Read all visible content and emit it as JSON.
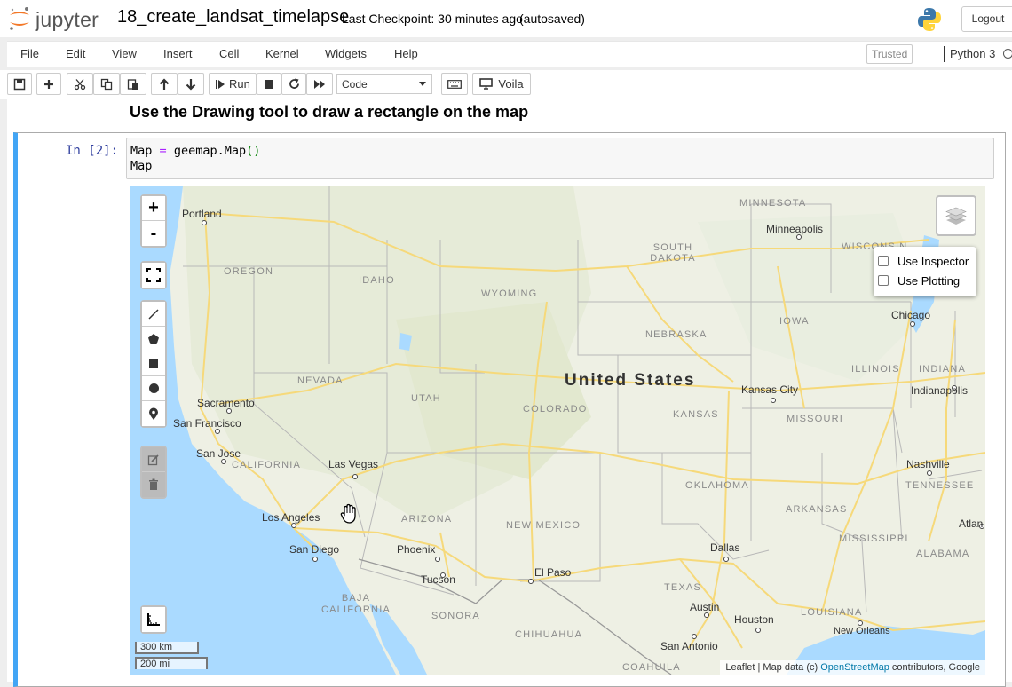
{
  "header": {
    "logo_text": "jupyter",
    "notebook_name": "18_create_landsat_timelapse",
    "checkpoint": "Last Checkpoint: 30 minutes ago",
    "autosave_status": "(autosaved)",
    "logout_label": "Logout"
  },
  "menubar": {
    "items": [
      "File",
      "Edit",
      "View",
      "Insert",
      "Cell",
      "Kernel",
      "Widgets",
      "Help"
    ],
    "trusted_label": "Trusted",
    "kernel_name": "Python 3"
  },
  "toolbar": {
    "run_label": "Run",
    "cell_type": "Code",
    "voila_label": "Voila",
    "icons": [
      "save-icon",
      "plus-icon",
      "cut-icon",
      "copy-icon",
      "paste-icon",
      "arrow-up-icon",
      "arrow-down-icon",
      "step-forward-icon",
      "stop-icon",
      "restart-icon",
      "fast-forward-icon",
      "keyboard-icon",
      "monitor-icon"
    ]
  },
  "notebook": {
    "markdown_heading": "Use the Drawing tool to draw a rectangle on the map",
    "cell": {
      "prompt": "In [2]:",
      "code_line1": {
        "var": "Map",
        "op": "=",
        "call": "geemap.Map",
        "parens": "()"
      },
      "code_line2": "Map"
    }
  },
  "map": {
    "zoom_in": "+",
    "zoom_out": "-",
    "country_label": "United States",
    "states": [
      "OREGON",
      "IDAHO",
      "WYOMING",
      "SOUTH DAKOTA",
      "MINNESOTA",
      "WISCONSIN",
      "IOWA",
      "NEBRASKA",
      "NEVADA",
      "UTAH",
      "COLORADO",
      "KANSAS",
      "MISSOURI",
      "ILLINOIS",
      "INDIANA",
      "CALIFORNIA",
      "ARIZONA",
      "NEW MEXICO",
      "OKLAHOMA",
      "ARKANSAS",
      "TENNESSEE",
      "MISSISSIPPI",
      "ALABAMA",
      "TEXAS",
      "LOUISIANA",
      "BAJA CALIFORNIA",
      "SONORA",
      "CHIHUAHUA",
      "COAHUILA"
    ],
    "cities": [
      "Portland",
      "Minneapolis",
      "Chicago",
      "Sacramento",
      "San Francisco",
      "San Jose",
      "Las Vegas",
      "Kansas City",
      "Indianapolis",
      "Nashville",
      "Los Angeles",
      "San Diego",
      "Phoenix",
      "Tucson",
      "El Paso",
      "Dallas",
      "Austin",
      "Houston",
      "San Antonio",
      "New Orleans",
      "Atlan"
    ],
    "inspector_label": "Use Inspector",
    "plotting_label": "Use Plotting",
    "scale_km": "300 km",
    "scale_mi": "200 mi",
    "attribution_prefix": "Leaflet | Map data (c) ",
    "attribution_link": "OpenStreetMap",
    "attribution_suffix": " contributors, Google",
    "colors": {
      "water": "#aadaff",
      "land": "#eef0e4",
      "highway": "#f6d97a",
      "cell_border": "#42a5f5"
    }
  }
}
